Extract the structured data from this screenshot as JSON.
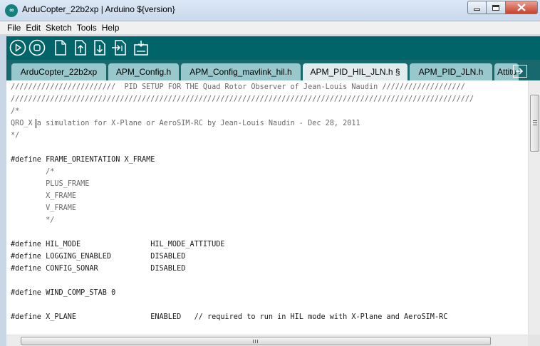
{
  "window": {
    "title": "ArduCopter_22b2xp | Arduino ${version}",
    "app_icon": "arduino-infinity-icon"
  },
  "menu": [
    "File",
    "Edit",
    "Sketch",
    "Tools",
    "Help"
  ],
  "toolbar": {
    "buttons": [
      "verify-icon",
      "stop-icon",
      "new-icon",
      "open-icon",
      "save-icon",
      "upload-icon",
      "serial-monitor-icon"
    ]
  },
  "tabs": [
    {
      "label": "ArduCopter_22b2xp",
      "active": false
    },
    {
      "label": "APM_Config.h",
      "active": false
    },
    {
      "label": "APM_Config_mavlink_hil.h",
      "active": false
    },
    {
      "label": "APM_PID_HIL_JLN.h §",
      "active": true
    },
    {
      "label": "APM_PID_JLN.h",
      "active": false
    },
    {
      "label": "Attitu",
      "active": false
    }
  ],
  "colors": {
    "toolbar": "#006468",
    "tab_inactive": "#99c8cc",
    "tab_active": "#e2ecec"
  },
  "code": {
    "lines": [
      "////////////////////////  PID SETUP FOR THE Quad Rotor Observer of Jean-Louis Naudin ///////////////////",
      "//////////////////////////////////////////////////////////////////////////////////////////////////////////",
      "/*",
      "QRO_X a simulation for X-Plane or AeroSIM-RC by Jean-Louis Naudin - Dec 28, 2011",
      "*/",
      "",
      "#define FRAME_ORIENTATION X_FRAME",
      "        /*",
      "        PLUS_FRAME",
      "        X_FRAME",
      "        V_FRAME",
      "        */",
      "",
      "#define HIL_MODE                HIL_MODE_ATTITUDE",
      "#define LOGGING_ENABLED         DISABLED",
      "#define CONFIG_SONAR            DISABLED",
      "",
      "#define WIND_COMP_STAB 0",
      "",
      "#define X_PLANE                 ENABLED   // required to run in HIL mode with X-Plane and AeroSIM-RC"
    ]
  }
}
